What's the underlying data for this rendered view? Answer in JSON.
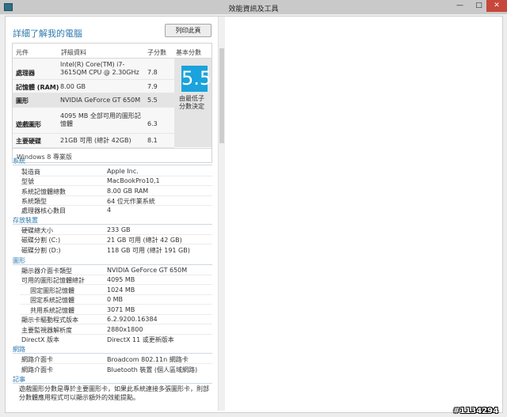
{
  "window": {
    "title": "效能資訊及工具",
    "min_glyph": "—",
    "max_glyph": "□",
    "close_glyph": "✕",
    "close_color": "#c7473a"
  },
  "header": {
    "title": "詳細了解我的電腦",
    "print_button": "列印此頁",
    "accent": "#2e7ab1"
  },
  "score_table": {
    "columns": [
      "元件",
      "評級資料",
      "子分數",
      "基本分數"
    ],
    "rows": [
      {
        "component": "處理器",
        "description": "Intel(R) Core(TM) i7-3615QM CPU @ 2.30GHz",
        "subscore": "7.8"
      },
      {
        "component": "記憶體 (RAM)",
        "description": "8.00 GB",
        "subscore": "7.9"
      },
      {
        "component": "圖形",
        "description": "NVIDIA GeForce GT 650M",
        "subscore": "5.5"
      },
      {
        "component": "遊戲圖形",
        "description": "4095 MB 全部可用的圖形記憶體",
        "subscore": "6.3"
      },
      {
        "component": "主要硬碟",
        "description": "21GB 可用 (總計 42GB)",
        "subscore": "8.1"
      }
    ],
    "base_score": "5.5",
    "base_note": "由最低子分數決定",
    "tile_color": "#1aa3dc",
    "edition": "Windows 8 專業版"
  },
  "sections": [
    {
      "title": "系統",
      "items": [
        {
          "label": "製造商",
          "value": "Apple Inc."
        },
        {
          "label": "型號",
          "value": "MacBookPro10,1"
        },
        {
          "label": "系統記憶體總數",
          "value": "8.00 GB RAM"
        },
        {
          "label": "系統類型",
          "value": "64 位元作業系統"
        },
        {
          "label": "處理器核心數目",
          "value": "4"
        }
      ]
    },
    {
      "title": "存放裝置",
      "items": [
        {
          "label": "硬碟總大小",
          "value": "233 GB"
        },
        {
          "label": "磁碟分割 (C:)",
          "value": "21 GB 可用 (總計 42 GB)"
        },
        {
          "label": "磁碟分割 (D:)",
          "value": "118 GB 可用 (總計 191 GB)"
        }
      ]
    },
    {
      "title": "圖形",
      "items": [
        {
          "label": "顯示器介面卡類型",
          "value": "NVIDIA GeForce GT 650M"
        },
        {
          "label": "可用的圖形記憶體總計",
          "value": "4095 MB"
        },
        {
          "label": "固定圖形記憶體",
          "value": "1024 MB"
        },
        {
          "label": "固定系統記憶體",
          "value": "0 MB"
        },
        {
          "label": "共用系統記憶體",
          "value": "3071 MB"
        },
        {
          "label": "顯示卡驅動程式版本",
          "value": "6.2.9200.16384"
        },
        {
          "label": "主要監視器解析度",
          "value": "2880x1800"
        },
        {
          "label": "DirectX 版本",
          "value": "DirectX 11 或更新版本"
        }
      ]
    },
    {
      "title": "網路",
      "items": [
        {
          "label": "網路介面卡",
          "value": "Broadcom 802.11n 網路卡"
        },
        {
          "label": "網路介面卡",
          "value": "Bluetooth 裝置 (個人區域網路)"
        }
      ]
    },
    {
      "title": "記事",
      "items": []
    }
  ],
  "notes_text": "遊戲圖形分數是專於主要圖形卡，如果此系統連接多張圖形卡，則部分數體應用程式可以顯示額外的效能提點。",
  "watermark": "#1134294"
}
